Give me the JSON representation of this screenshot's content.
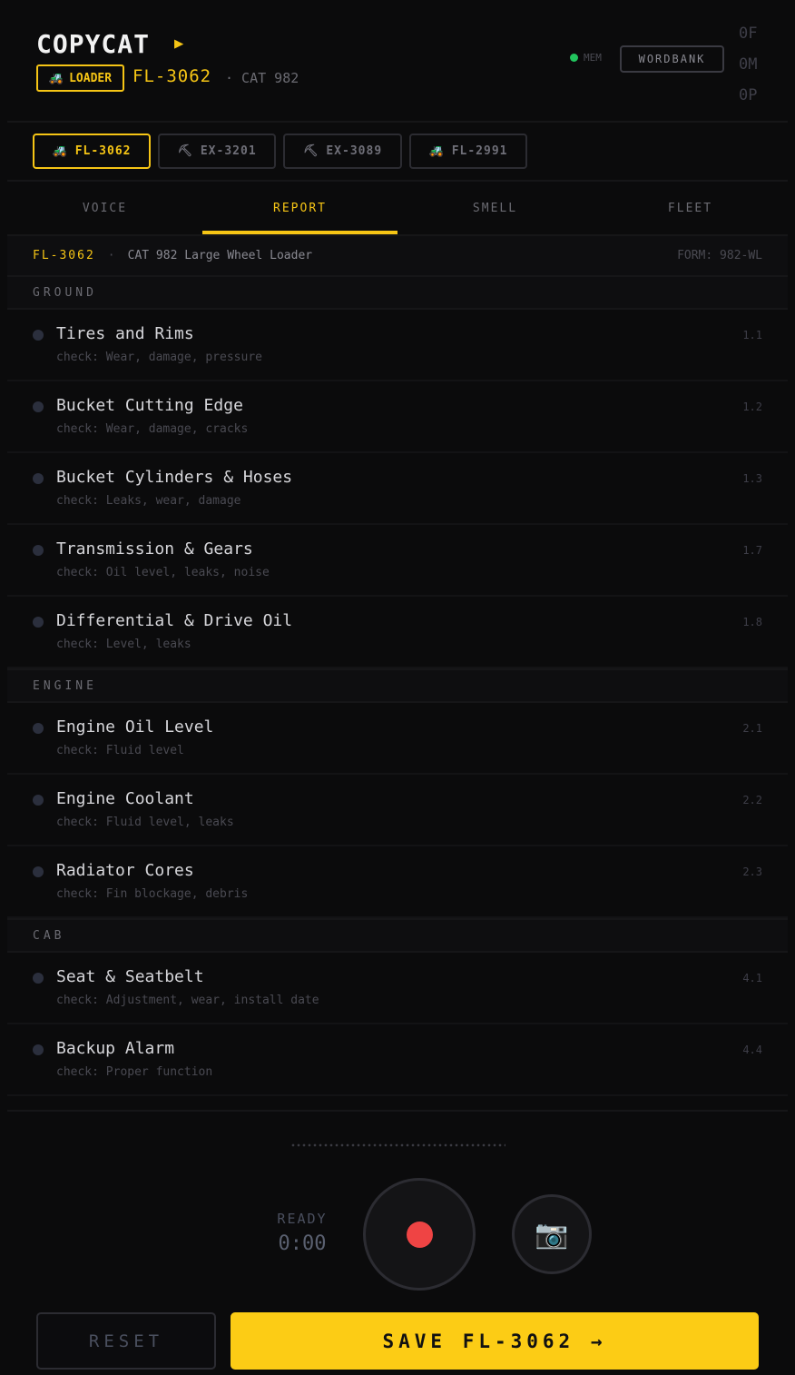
{
  "header": {
    "brand": "COPYCAT",
    "brand_arrow": "▶",
    "type_badge_icon": "🚜",
    "type_badge": "LOADER",
    "unit_id": "FL-3062",
    "unit_model": "· CAT 982",
    "mem_label": "MEM",
    "wordbank": "WORDBANK",
    "counters": [
      "0F",
      "0M",
      "0P"
    ],
    "colors": {
      "accent": "#f6c515",
      "mem_dot": "#22c55e",
      "record": "#ef4444"
    }
  },
  "unit_tabs": [
    {
      "icon": "🚜",
      "icon_name": "loader-icon",
      "label": "FL-3062",
      "active": true
    },
    {
      "icon": "⛏",
      "icon_name": "pickaxe-icon",
      "label": "EX-3201",
      "active": false
    },
    {
      "icon": "⛏",
      "icon_name": "pickaxe-icon",
      "label": "EX-3089",
      "active": false
    },
    {
      "icon": "🚜",
      "icon_name": "loader-icon",
      "label": "FL-2991",
      "active": false
    }
  ],
  "main_tabs": [
    {
      "label": "VOICE",
      "active": false
    },
    {
      "label": "REPORT",
      "active": true
    },
    {
      "label": "SMELL",
      "active": false
    },
    {
      "label": "FLEET",
      "active": false
    }
  ],
  "form_bar": {
    "unit_id": "FL-3062",
    "separator": "·",
    "name": "CAT 982 Large Wheel Loader",
    "form_code": "FORM: 982-WL"
  },
  "sections": [
    {
      "title": "GROUND",
      "items": [
        {
          "title": "Tires and Rims",
          "check": "check: Wear, damage, pressure",
          "num": "1.1"
        },
        {
          "title": "Bucket Cutting Edge",
          "check": "check: Wear, damage, cracks",
          "num": "1.2"
        },
        {
          "title": "Bucket Cylinders & Hoses",
          "check": "check: Leaks, wear, damage",
          "num": "1.3"
        },
        {
          "title": "Transmission & Gears",
          "check": "check: Oil level, leaks, noise",
          "num": "1.7"
        },
        {
          "title": "Differential & Drive Oil",
          "check": "check: Level, leaks",
          "num": "1.8"
        }
      ]
    },
    {
      "title": "ENGINE",
      "items": [
        {
          "title": "Engine Oil Level",
          "check": "check: Fluid level",
          "num": "2.1"
        },
        {
          "title": "Engine Coolant",
          "check": "check: Fluid level, leaks",
          "num": "2.2"
        },
        {
          "title": "Radiator Cores",
          "check": "check: Fin blockage, debris",
          "num": "2.3"
        }
      ]
    },
    {
      "title": "CAB",
      "items": [
        {
          "title": "Seat & Seatbelt",
          "check": "check: Adjustment, wear, install date",
          "num": "4.1"
        },
        {
          "title": "Backup Alarm",
          "check": "check: Proper function",
          "num": "4.4"
        }
      ]
    }
  ],
  "recorder": {
    "status": "READY",
    "time": "0:00",
    "camera_icon": "📷"
  },
  "actions": {
    "reset": "RESET",
    "save": "SAVE FL-3062 →"
  }
}
